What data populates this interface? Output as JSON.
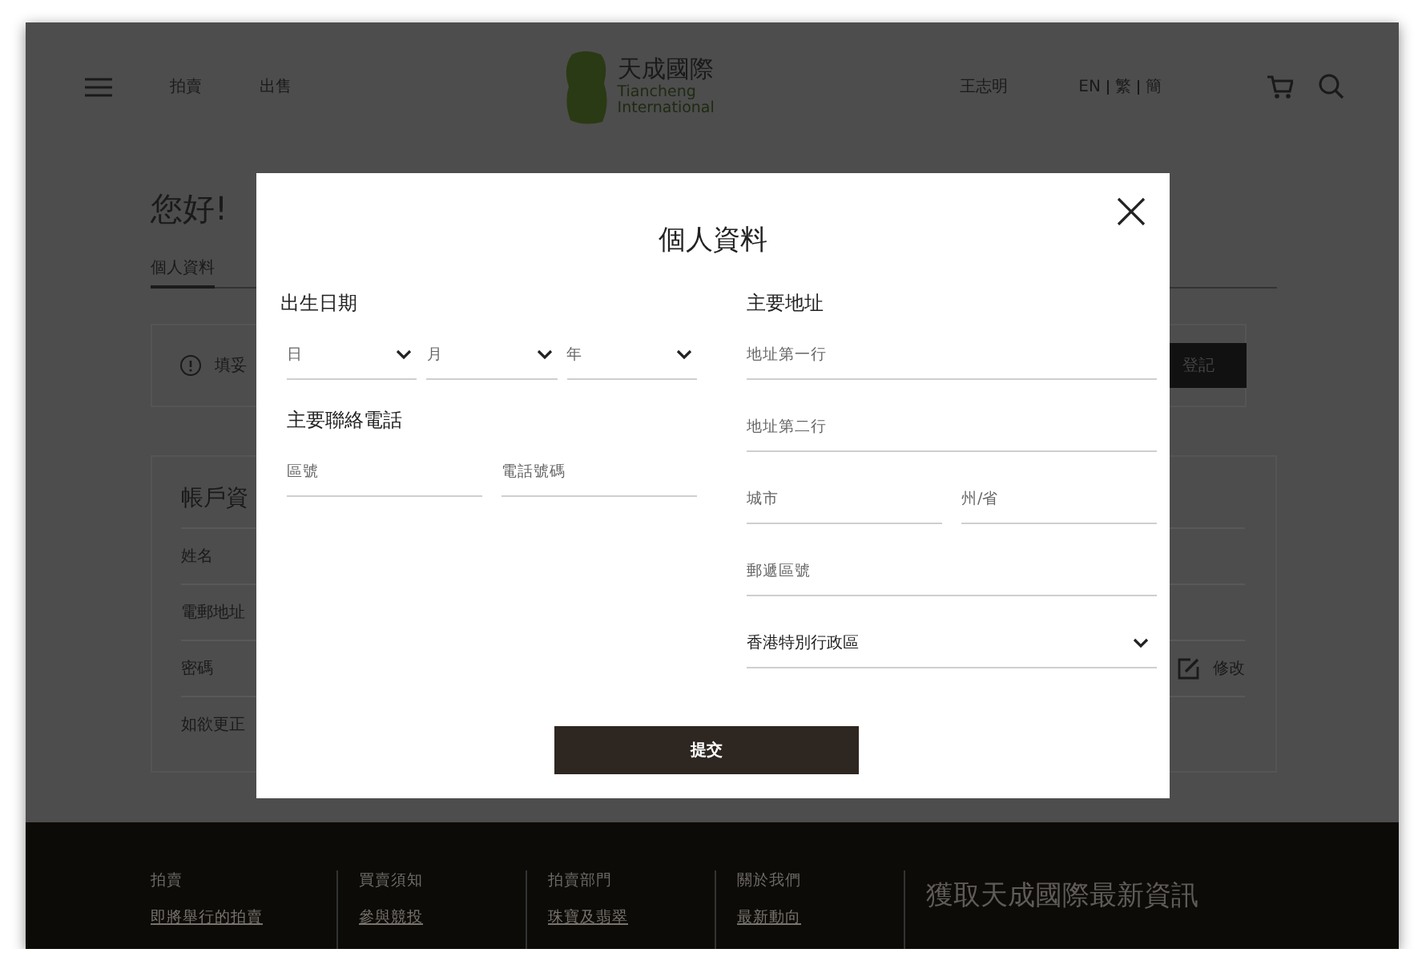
{
  "header": {
    "nav": [
      "拍賣",
      "出售"
    ],
    "logo": {
      "name_zh": "天成國際",
      "name_en_1": "Tiancheng",
      "name_en_2": "International"
    },
    "user": "王志明",
    "languages": [
      "EN",
      "繁",
      "簡"
    ]
  },
  "page": {
    "greeting": "您好!",
    "tabs": [
      {
        "label": "個人資料",
        "selected": true
      }
    ],
    "notice": {
      "text": "填妥",
      "button": "登記"
    },
    "account": {
      "title": "帳戶資",
      "rows": [
        {
          "label": "姓名"
        },
        {
          "label": "電郵地址"
        },
        {
          "label": "密碼",
          "action": "修改"
        }
      ],
      "note": "如欲更正"
    }
  },
  "modal": {
    "title": "個人資料",
    "left": [
      {
        "heading": "出生日期",
        "fields": [
          {
            "kind": "select",
            "placeholder": "日"
          },
          {
            "kind": "select",
            "placeholder": "月"
          },
          {
            "kind": "select",
            "placeholder": "年"
          }
        ]
      },
      {
        "heading": "主要聯絡電話",
        "fields": [
          {
            "kind": "text",
            "placeholder": "區號"
          },
          {
            "kind": "text",
            "placeholder": "電話號碼"
          }
        ]
      }
    ],
    "address": {
      "heading": "主要地址",
      "rows": [
        [
          {
            "kind": "text",
            "placeholder": "地址第一行"
          }
        ],
        [
          {
            "kind": "text",
            "placeholder": "地址第二行"
          }
        ],
        [
          {
            "kind": "text",
            "placeholder": "城市"
          },
          {
            "kind": "text",
            "placeholder": "州/省"
          }
        ],
        [
          {
            "kind": "text",
            "placeholder": "郵遞區號"
          }
        ],
        [
          {
            "kind": "select",
            "value": "香港特別行政區"
          }
        ]
      ]
    },
    "submit": "提交"
  },
  "footer": {
    "columns": [
      {
        "heading": "拍賣",
        "links": [
          "即將舉行的拍賣"
        ]
      },
      {
        "heading": "買賣須知",
        "links": [
          "參與競投"
        ]
      },
      {
        "heading": "拍賣部門",
        "links": [
          "珠寶及翡翠"
        ]
      },
      {
        "heading": "關於我們",
        "links": [
          "最新動向"
        ]
      }
    ],
    "newsletter": "獲取天成國際最新資訊"
  }
}
